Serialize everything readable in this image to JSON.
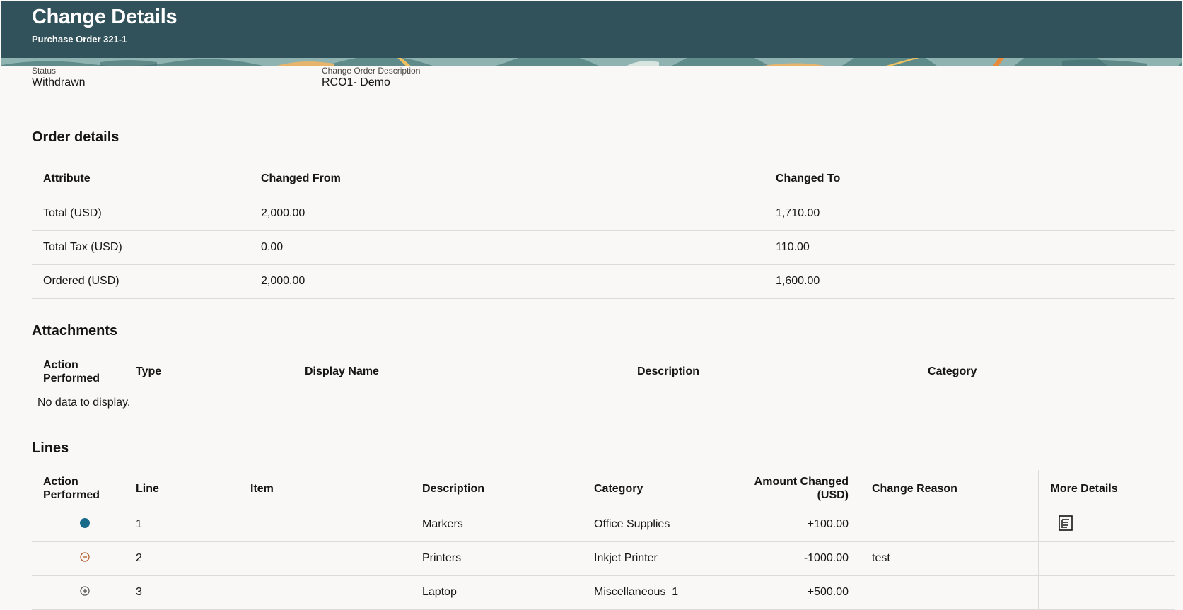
{
  "header": {
    "title": "Change Details",
    "subtitle": "Purchase Order 321-1"
  },
  "summary": {
    "status_label": "Status",
    "status_value": "Withdrawn",
    "desc_label": "Change Order Description",
    "desc_value": "RCO1- Demo"
  },
  "order_details": {
    "title": "Order details",
    "columns": [
      "Attribute",
      "Changed From",
      "Changed To"
    ],
    "rows": [
      {
        "attribute": "Total (USD)",
        "from": "2,000.00",
        "to": "1,710.00"
      },
      {
        "attribute": "Total Tax (USD)",
        "from": "0.00",
        "to": "110.00"
      },
      {
        "attribute": "Ordered (USD)",
        "from": "2,000.00",
        "to": "1,600.00"
      }
    ]
  },
  "attachments": {
    "title": "Attachments",
    "columns": [
      "Action Performed",
      "Type",
      "Display Name",
      "Description",
      "Category"
    ],
    "empty_text": "No data to display."
  },
  "lines": {
    "title": "Lines",
    "columns": [
      "Action Performed",
      "Line",
      "Item",
      "Description",
      "Category",
      "Amount Changed (USD)",
      "Change Reason",
      "More Details"
    ],
    "rows": [
      {
        "action_icon": "filled-circle-icon",
        "line": "1",
        "item": "",
        "description": "Markers",
        "category": "Office Supplies",
        "amount": "+100.00",
        "reason": "",
        "details_icon": "details-icon"
      },
      {
        "action_icon": "minus-circle-icon",
        "line": "2",
        "item": "",
        "description": "Printers",
        "category": "Inkjet Printer",
        "amount": "-1000.00",
        "reason": "test",
        "details_icon": ""
      },
      {
        "action_icon": "plus-circle-icon",
        "line": "3",
        "item": "",
        "description": "Laptop",
        "category": "Miscellaneous_1",
        "amount": "+500.00",
        "reason": "",
        "details_icon": ""
      }
    ]
  },
  "colors": {
    "header_bg": "#31525a",
    "changed_dot": "#1a6a8a",
    "minus_icon": "#b65e2c",
    "plus_icon": "#5a5854"
  }
}
